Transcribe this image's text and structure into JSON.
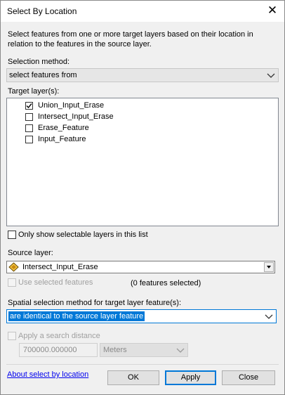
{
  "window": {
    "title": "Select By Location",
    "close_glyph": "✕",
    "close_icon": "close-icon"
  },
  "description": "Select features from one or more target layers based on their location in relation to the features in the source layer.",
  "selection_method": {
    "label": "Selection method:",
    "value": "select features from"
  },
  "target_layers": {
    "label": "Target layer(s):",
    "items": [
      {
        "label": "Union_Input_Erase",
        "checked": true
      },
      {
        "label": "Intersect_Input_Erase",
        "checked": false
      },
      {
        "label": "Erase_Feature",
        "checked": false
      },
      {
        "label": "Input_Feature",
        "checked": false
      }
    ],
    "only_selectable_label": "Only show selectable layers in this list"
  },
  "source_layer": {
    "label": "Source layer:",
    "value": "Intersect_Input_Erase",
    "icon": "polygon-layer-icon",
    "use_selected_label": "Use selected features",
    "features_selected_text": "(0 features selected)"
  },
  "spatial": {
    "label": "Spatial selection method for target layer feature(s):",
    "value": "are identical to the source layer feature"
  },
  "search_distance": {
    "label": "Apply a search distance",
    "value": "700000.000000",
    "units": "Meters"
  },
  "footer": {
    "about_link": "About select by location",
    "ok": "OK",
    "apply": "Apply",
    "close": "Close"
  },
  "colors": {
    "accent": "#0078d7",
    "background": "#f0f0f0",
    "link": "#0000ee"
  }
}
